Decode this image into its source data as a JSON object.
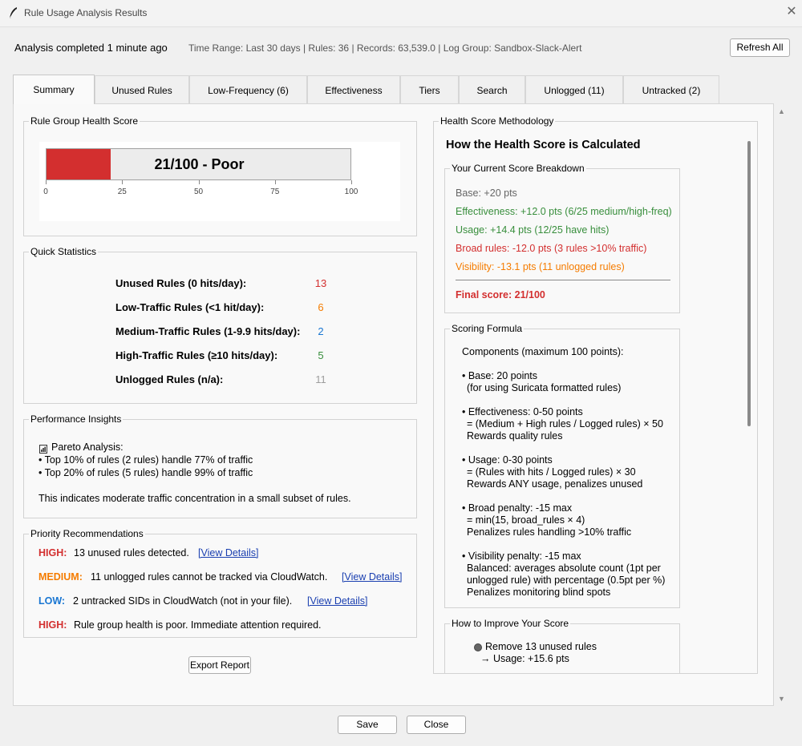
{
  "window": {
    "title": "Rule Usage Analysis Results",
    "close_glyph": "✕",
    "app_icon": "feather-icon"
  },
  "status": {
    "main": "Analysis completed 1 minute ago",
    "info": "Time Range: Last 30 days | Rules: 36 | Records: 63,539.0 | Log Group: Sandbox-Slack-Alert",
    "refresh_label": "Refresh All"
  },
  "tabs": [
    "Summary",
    "Unused Rules",
    "Low-Frequency (6)",
    "Effectiveness",
    "Tiers",
    "Search",
    "Unlogged (11)",
    "Untracked (2)"
  ],
  "active_tab": "Summary",
  "health": {
    "title": "Rule Group Health Score",
    "score": 21,
    "label": "21/100 - Poor",
    "ticks": [
      "0",
      "25",
      "50",
      "75",
      "100"
    ],
    "bar_color": "#d32f2f"
  },
  "quick_stats": {
    "title": "Quick Statistics",
    "rows": [
      {
        "label": "Unused Rules (0 hits/day):",
        "value": "13",
        "color": "#d32f2f"
      },
      {
        "label": "Low-Traffic Rules (<1 hit/day):",
        "value": "6",
        "color": "#f57c00"
      },
      {
        "label": "Medium-Traffic Rules (1-9.9 hits/day):",
        "value": "2",
        "color": "#1976d2"
      },
      {
        "label": "High-Traffic Rules (≥10 hits/day):",
        "value": "5",
        "color": "#388e3c"
      },
      {
        "label": "Unlogged Rules (n/a):",
        "value": "11",
        "color": "#9e9e9e"
      }
    ]
  },
  "insights": {
    "title": "Performance Insights",
    "icon": "chart-icon",
    "heading": "Pareto Analysis:",
    "lines": [
      "• Top 10% of rules (2 rules) handle 77% of traffic",
      "• Top 20% of rules (5 rules) handle 99% of traffic"
    ],
    "note": "This indicates moderate traffic concentration in a small subset of rules."
  },
  "recommendations": {
    "title": "Priority Recommendations",
    "items": [
      {
        "severity": "HIGH:",
        "color": "#d32f2f",
        "text": "13 unused rules detected.",
        "link": "[View Details]"
      },
      {
        "severity": "MEDIUM:",
        "color": "#f57c00",
        "text": "11 unlogged rules cannot be tracked via CloudWatch.",
        "link": "[View Details]"
      },
      {
        "severity": "LOW:",
        "color": "#1976d2",
        "text": "2 untracked SIDs in CloudWatch (not in your file).",
        "link": "[View Details]"
      },
      {
        "severity": "HIGH:",
        "color": "#d32f2f",
        "text": "Rule group health is poor. Immediate attention required.",
        "link": ""
      }
    ]
  },
  "export_label": "Export Report",
  "methodology": {
    "title": "Health Score Methodology",
    "heading": "How the Health Score is Calculated",
    "breakdown_title": "Your Current Score Breakdown",
    "breakdown": [
      {
        "text": "Base: +20 pts",
        "color": "#666666"
      },
      {
        "text": "Effectiveness: +12.0 pts (6/25 medium/high-freq)",
        "color": "#388e3c"
      },
      {
        "text": "Usage: +14.4 pts (12/25 have hits)",
        "color": "#388e3c"
      },
      {
        "text": "Broad rules: -12.0 pts (3 rules >10% traffic)",
        "color": "#d32f2f"
      },
      {
        "text": "Visibility: -13.1 pts (11 unlogged rules)",
        "color": "#f57c00"
      }
    ],
    "final": "Final score: 21/100",
    "final_color": "#d32f2f",
    "formula_title": "Scoring Formula",
    "formula_lines": [
      "Components (maximum 100 points):",
      "• Base: 20 points",
      "(for using Suricata formatted rules)",
      "• Effectiveness: 0-50 points",
      "= (Medium + High rules / Logged rules) × 50",
      "Rewards quality rules",
      "• Usage: 0-30 points",
      "= (Rules with hits / Logged rules) × 30",
      "Rewards ANY usage, penalizes unused",
      "• Broad penalty: -15 max",
      "= min(15, broad_rules × 4)",
      "Penalizes rules handling >10% traffic",
      "• Visibility penalty: -15 max",
      "Balanced: averages absolute count (1pt per",
      "unlogged rule) with percentage (0.5pt per %)",
      "Penalizes monitoring blind spots"
    ],
    "improve_title": "How to Improve Your Score",
    "improve_icon": "bullet-circle-icon",
    "improve_item": "Remove 13 unused rules",
    "improve_sub": "→ Usage: +15.6 pts"
  },
  "footer": {
    "save_label": "Save",
    "close_label": "Close"
  }
}
